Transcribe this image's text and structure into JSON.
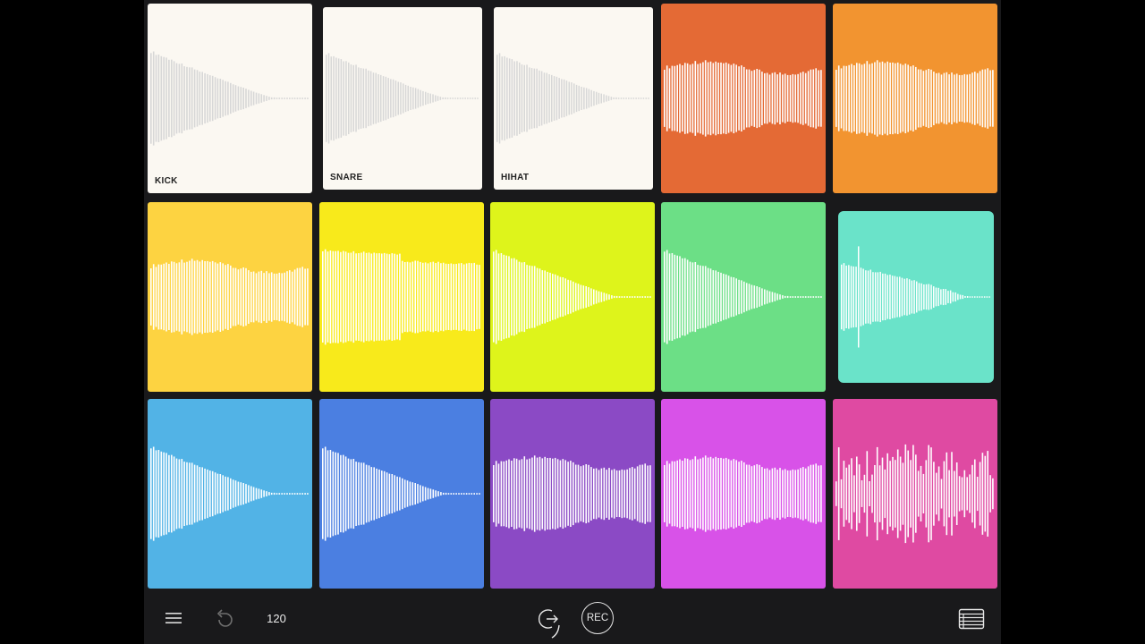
{
  "toolbar": {
    "menu_icon": "hamburger-menu-icon",
    "undo_icon": "undo-icon",
    "tempo": "120",
    "loop_icon": "loop-arrow-icon",
    "rec_label": "REC",
    "list_icon": "table-list-icon"
  },
  "pads": [
    {
      "label": "KICK",
      "color": "#fbf8f2",
      "wave": "decay",
      "bars": "#d7d7d7"
    },
    {
      "label": "SNARE",
      "color": "#fbf8f2",
      "wave": "decay",
      "bars": "#d7d7d7"
    },
    {
      "label": "HIHAT",
      "color": "#fbf8f2",
      "wave": "decay",
      "bars": "#d7d7d7"
    },
    {
      "label": "",
      "color": "#e46a35",
      "wave": "sustain",
      "bars": "#ffffff"
    },
    {
      "label": "",
      "color": "#f29430",
      "wave": "sustain",
      "bars": "#ffffff"
    },
    {
      "label": "",
      "color": "#fdd341",
      "wave": "sustain",
      "bars": "#ffffff"
    },
    {
      "label": "",
      "color": "#f8ea1b",
      "wave": "swell",
      "bars": "#ffffff"
    },
    {
      "label": "",
      "color": "#def41b",
      "wave": "decay",
      "bars": "#ffffff"
    },
    {
      "label": "",
      "color": "#6cdf86",
      "wave": "decay",
      "bars": "#ffffff"
    },
    {
      "label": "",
      "color": "#6ae3c9",
      "wave": "spike-decay",
      "bars": "#ffffff"
    },
    {
      "label": "",
      "color": "#52b3e6",
      "wave": "decay",
      "bars": "#ffffff"
    },
    {
      "label": "",
      "color": "#4b7fe1",
      "wave": "decay",
      "bars": "#ffffff"
    },
    {
      "label": "",
      "color": "#8b4ac5",
      "wave": "sustain",
      "bars": "#ffffff"
    },
    {
      "label": "",
      "color": "#d852e8",
      "wave": "sustain",
      "bars": "#ffffff"
    },
    {
      "label": "",
      "color": "#df4aa2",
      "wave": "choppy",
      "bars": "#ffffff"
    }
  ]
}
